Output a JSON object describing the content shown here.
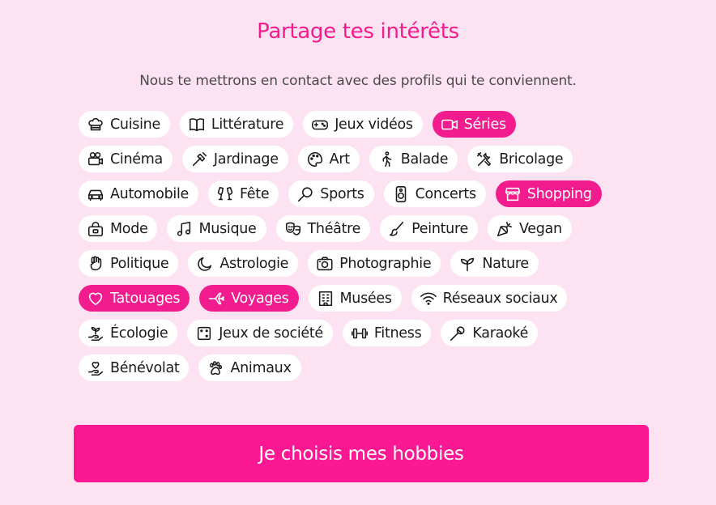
{
  "title": "Partage tes intérêts",
  "subtitle": "Nous te mettrons en contact avec des profils qui te conviennent.",
  "colors": {
    "background": "#fde3f1",
    "accent": "#f21c8e",
    "chip_background": "#ffffff"
  },
  "interests": [
    [
      {
        "label": "Cuisine",
        "icon": "chef-hat-icon",
        "selected": false
      },
      {
        "label": "Littérature",
        "icon": "book-icon",
        "selected": false
      },
      {
        "label": "Jeux vidéos",
        "icon": "gamepad-icon",
        "selected": false
      },
      {
        "label": "Séries",
        "icon": "video-camera-icon",
        "selected": true
      }
    ],
    [
      {
        "label": "Cinéma",
        "icon": "film-projector-icon",
        "selected": false
      },
      {
        "label": "Jardinage",
        "icon": "shovel-icon",
        "selected": false
      },
      {
        "label": "Art",
        "icon": "palette-icon",
        "selected": false
      },
      {
        "label": "Balade",
        "icon": "walking-person-icon",
        "selected": false
      },
      {
        "label": "Bricolage",
        "icon": "tools-icon",
        "selected": false
      }
    ],
    [
      {
        "label": "Automobile",
        "icon": "car-icon",
        "selected": false
      },
      {
        "label": "Fête",
        "icon": "champagne-glasses-icon",
        "selected": false
      },
      {
        "label": "Sports",
        "icon": "racket-icon",
        "selected": false
      },
      {
        "label": "Concerts",
        "icon": "speaker-icon",
        "selected": false
      },
      {
        "label": "Shopping",
        "icon": "storefront-icon",
        "selected": true
      }
    ],
    [
      {
        "label": "Mode",
        "icon": "handbag-icon",
        "selected": false
      },
      {
        "label": "Musique",
        "icon": "music-note-icon",
        "selected": false
      },
      {
        "label": "Théâtre",
        "icon": "theater-masks-icon",
        "selected": false
      },
      {
        "label": "Peinture",
        "icon": "paintbrush-icon",
        "selected": false
      },
      {
        "label": "Vegan",
        "icon": "carrot-icon",
        "selected": false
      }
    ],
    [
      {
        "label": "Politique",
        "icon": "raised-fist-icon",
        "selected": false
      },
      {
        "label": "Astrologie",
        "icon": "moon-icon",
        "selected": false
      },
      {
        "label": "Photographie",
        "icon": "camera-icon",
        "selected": false
      },
      {
        "label": "Nature",
        "icon": "sprout-icon",
        "selected": false
      }
    ],
    [
      {
        "label": "Tatouages",
        "icon": "heart-icon",
        "selected": true
      },
      {
        "label": "Voyages",
        "icon": "airplane-icon",
        "selected": true
      },
      {
        "label": "Musées",
        "icon": "building-icon",
        "selected": false
      },
      {
        "label": "Réseaux sociaux",
        "icon": "wifi-icon",
        "selected": false
      }
    ],
    [
      {
        "label": "Écologie",
        "icon": "plant-in-hand-icon",
        "selected": false
      },
      {
        "label": "Jeux de société",
        "icon": "dice-icon",
        "selected": false
      },
      {
        "label": "Fitness",
        "icon": "dumbbell-icon",
        "selected": false
      },
      {
        "label": "Karaoké",
        "icon": "microphone-icon",
        "selected": false
      }
    ],
    [
      {
        "label": "Bénévolat",
        "icon": "heart-in-hand-icon",
        "selected": false
      },
      {
        "label": "Animaux",
        "icon": "paw-icon",
        "selected": false
      }
    ]
  ],
  "cta": {
    "label": "Je choisis mes hobbies"
  }
}
